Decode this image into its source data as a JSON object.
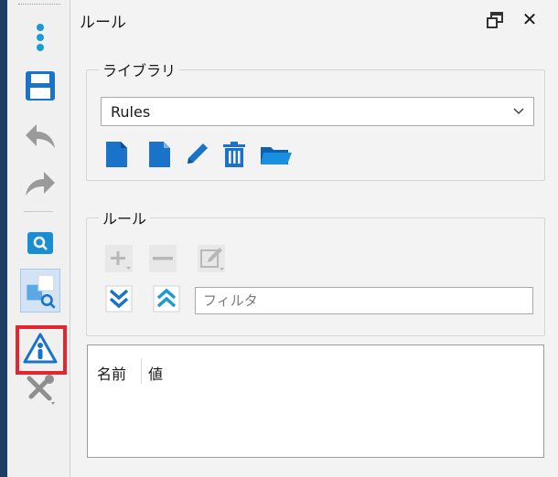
{
  "toolbar": {
    "items": [
      {
        "icon": "vertical-dots-icon"
      },
      {
        "icon": "save-icon"
      },
      {
        "icon": "undo-arrow-icon"
      },
      {
        "icon": "redo-arrow-icon"
      },
      {
        "icon": "search-screenshot-icon"
      },
      {
        "icon": "zoom-shapes-icon"
      },
      {
        "icon": "warning-triangle-icon",
        "highlighted": true
      },
      {
        "icon": "tools-icon"
      }
    ],
    "highlight_color": "#e3262f",
    "accent_color": "#1c3f63"
  },
  "panel": {
    "title": "ルール",
    "float_glyph": "🗗",
    "close_glyph": "✕"
  },
  "library": {
    "legend": "ライブラリ",
    "selected": "Rules",
    "actions": [
      "new-rule-icon",
      "new-document-icon",
      "edit-pencil-icon",
      "delete-trash-icon",
      "open-folder-icon"
    ]
  },
  "rules": {
    "legend": "ルール",
    "actions": [
      "add-icon",
      "remove-icon",
      "edit-disabled-icon"
    ],
    "expand_all_icon": "expand-all-icon",
    "collapse_all_icon": "collapse-all-icon",
    "filter_placeholder": "フィルタ"
  },
  "properties": {
    "columns": [
      "名前",
      "値"
    ]
  },
  "colors": {
    "icon_blue": "#1a73c8",
    "disabled_gray": "#b8b8b8",
    "panel_bg": "#f3f3f3"
  }
}
